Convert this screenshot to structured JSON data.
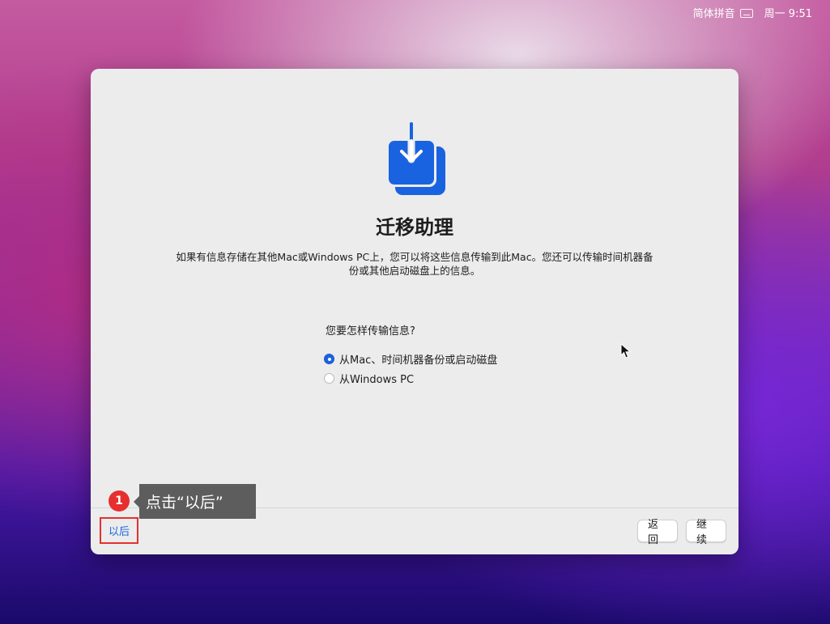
{
  "menubar": {
    "input_method": "简体拼音",
    "clock": "周一 9:51"
  },
  "window": {
    "title": "迁移助理",
    "description_line1": "如果有信息存储在其他Mac或Windows PC上，您可以将这些信息传输到此Mac。您还可以传输时间机器备",
    "description_line2": "份或其他启动磁盘上的信息。",
    "question": "您要怎样传输信息?",
    "options": [
      {
        "label": "从Mac、时间机器备份或启动磁盘",
        "selected": true
      },
      {
        "label": "从Windows PC",
        "selected": false
      }
    ],
    "later_label": "以后",
    "back_label": "返回",
    "continue_label": "继续"
  },
  "annotation": {
    "step_number": "1",
    "tooltip": "点击“以后”"
  },
  "colors": {
    "accent": "#1a63e0",
    "highlight": "#e5302f"
  },
  "icons": {
    "app": "migration-download-icon",
    "keyboard": "keyboard-icon",
    "cursor": "pointer-cursor-icon"
  }
}
